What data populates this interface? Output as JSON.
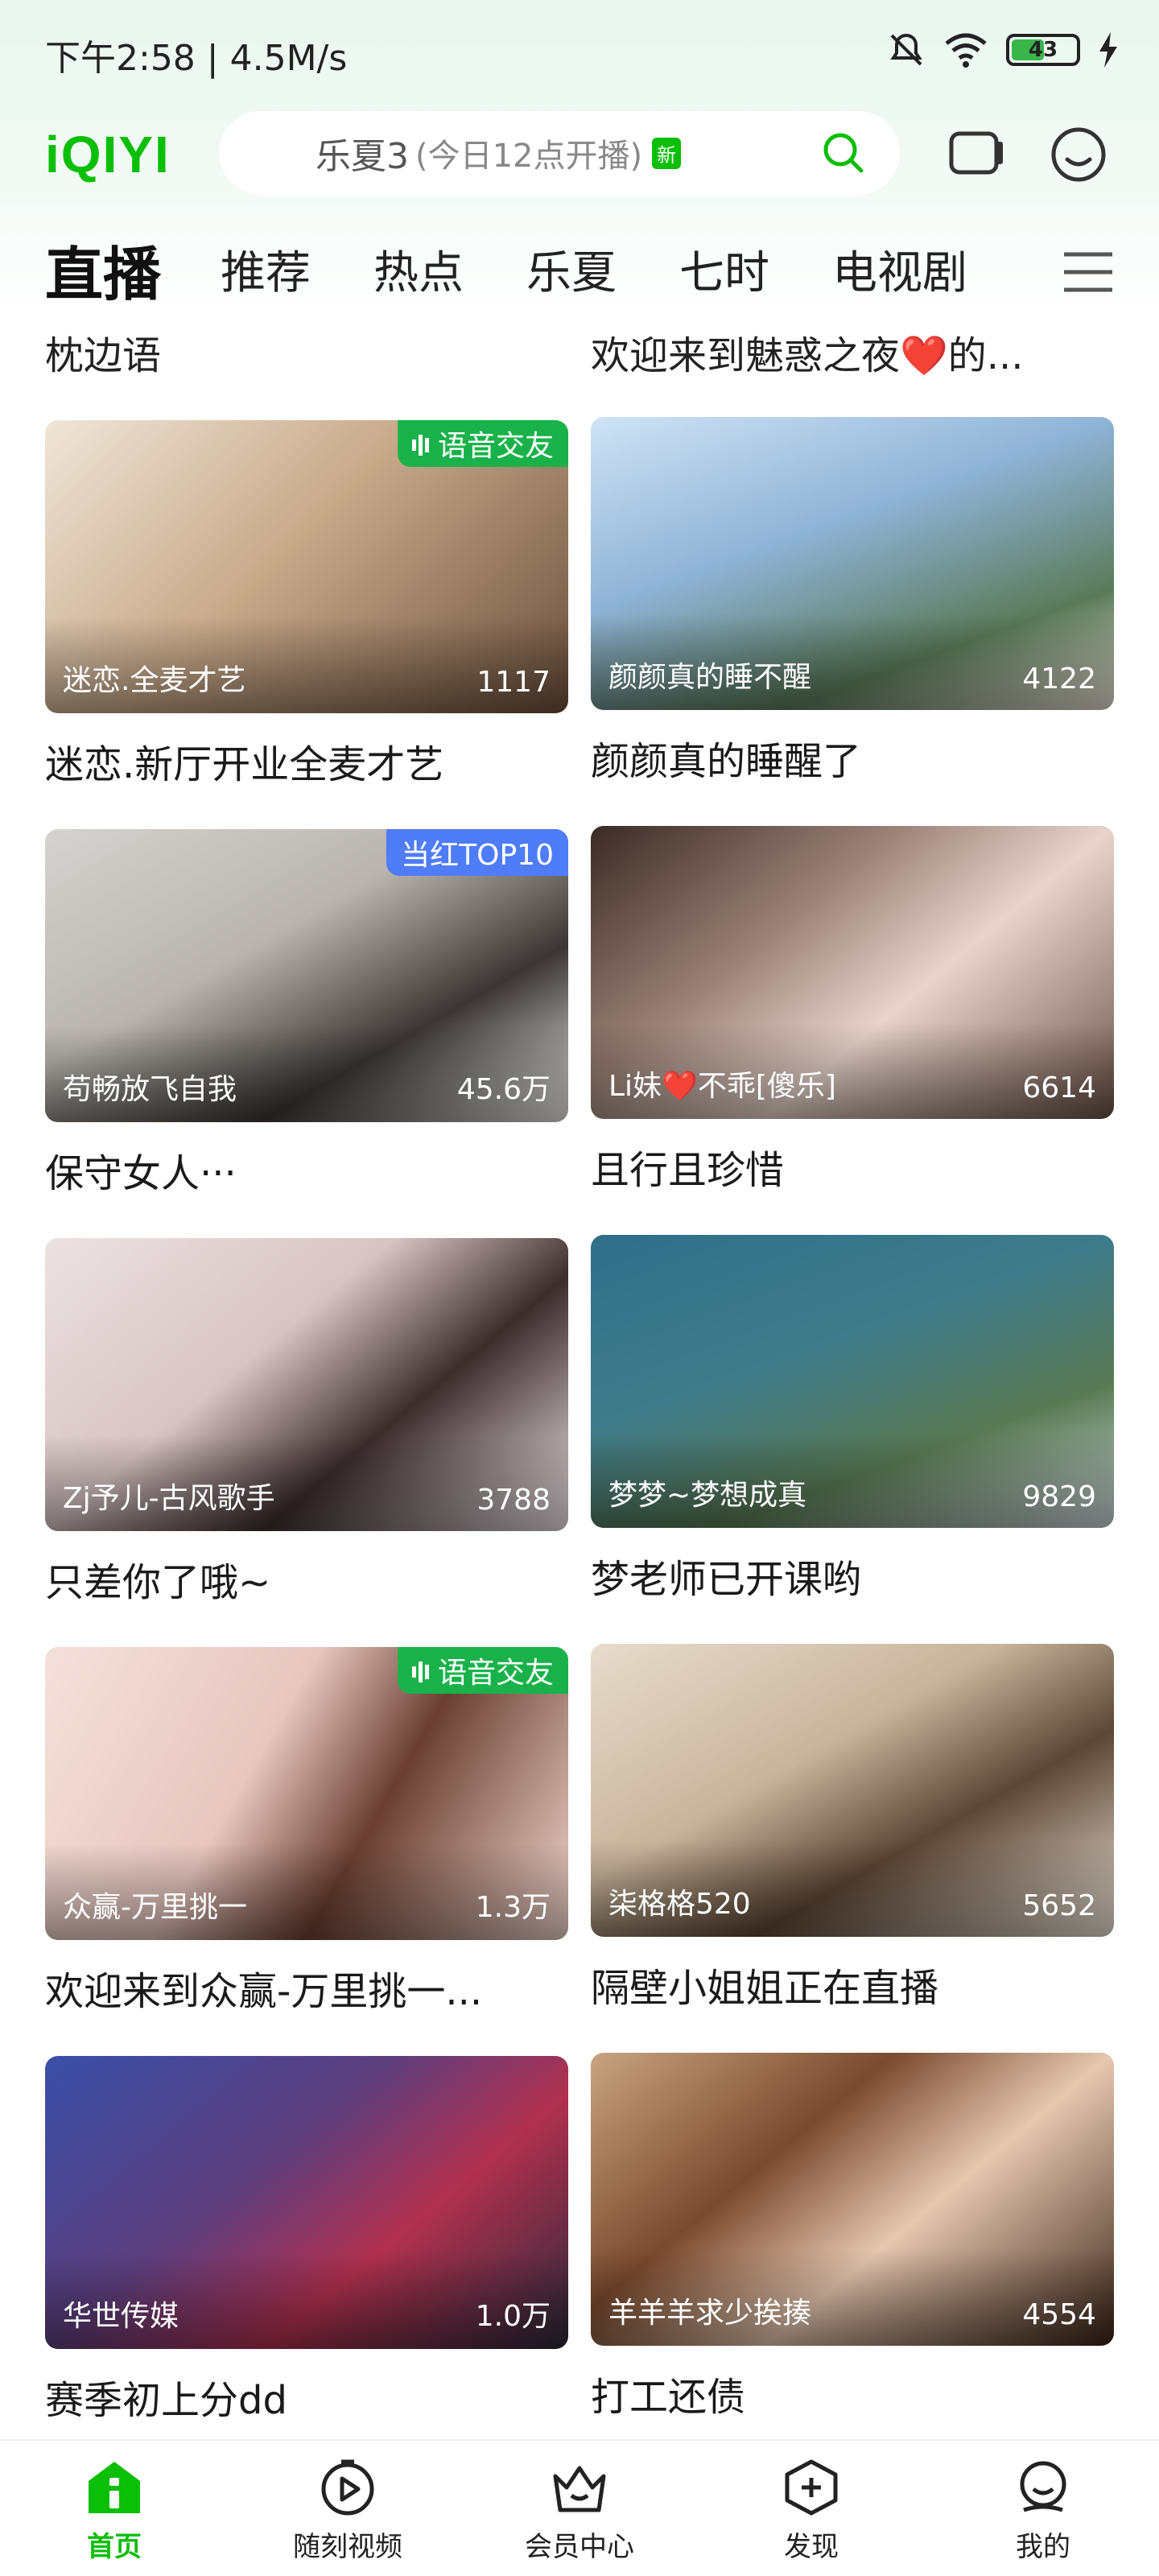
{
  "status_bar": {
    "time": "下午2:58 | 4.5M/s",
    "battery": "43"
  },
  "header": {
    "logo": "iQIYI",
    "search_main": "乐夏3",
    "search_sub": "(今日12点开播)",
    "search_badge": "新"
  },
  "tabs": [
    "直播",
    "推荐",
    "热点",
    "乐夏",
    "七时",
    "电视剧"
  ],
  "partial_titles": [
    "枕边语",
    "欢迎来到魅惑之夜❤️的..."
  ],
  "cards": [
    {
      "name": "迷恋.全麦才艺",
      "count": "1117",
      "title": "迷恋.新厅开业全麦才艺",
      "tag": "语音交友",
      "tag_color": "#19b24a",
      "bg": "#c8a98a"
    },
    {
      "name": "颜颜真的睡不醒",
      "count": "4122",
      "title": "颜颜真的睡醒了",
      "tag": "",
      "bg": "#8fb3d6"
    },
    {
      "name": "苟畅放飞自我",
      "count": "45.6万",
      "title": "保守女人···",
      "tag": "当红TOP10",
      "tag_color": "#4f7cf7",
      "bg": "#b9b4ae"
    },
    {
      "name": "Li妹❤️不乖[傻乐]",
      "count": "6614",
      "title": "且行且珍惜",
      "tag": "",
      "bg": "#9a8176"
    },
    {
      "name": "Zj予儿-古风歌手",
      "count": "3788",
      "title": "只差你了哦~",
      "tag": "",
      "bg": "#d8c4c4"
    },
    {
      "name": "梦梦~梦想成真",
      "count": "9829",
      "title": "梦老师已开课哟",
      "tag": "",
      "bg": "#3f7b8a"
    },
    {
      "name": "众赢-万里挑一",
      "count": "1.3万",
      "title": "欢迎来到众赢-万里挑一...",
      "tag": "语音交友",
      "tag_color": "#19b24a",
      "bg": "#e7c6bf"
    },
    {
      "name": "柒格格520",
      "count": "5652",
      "title": "隔壁小姐姐正在直播",
      "tag": "",
      "bg": "#c8b49c"
    },
    {
      "name": "华世传媒",
      "count": "1.0万",
      "title": "赛季初上分dd",
      "tag": "",
      "bg": "#5d3f7d"
    },
    {
      "name": "羊羊羊求少挨揍",
      "count": "4554",
      "title": "打工还债",
      "tag": "",
      "bg": "#7a4a2f"
    }
  ],
  "bottom_nav": [
    "首页",
    "随刻视频",
    "会员中心",
    "发现",
    "我的"
  ],
  "colors": {
    "accent": "#0bbe06",
    "tag_green": "#19b24a",
    "tag_blue": "#4f7cf7"
  }
}
